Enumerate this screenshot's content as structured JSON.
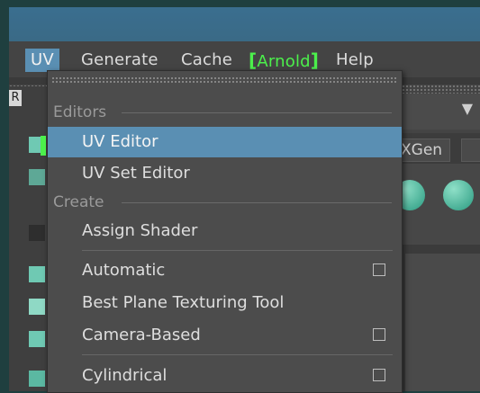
{
  "menubar": {
    "items": [
      {
        "label": "UV",
        "active": true
      },
      {
        "label": "Generate"
      },
      {
        "label": "Cache"
      },
      {
        "label": "Arnold"
      },
      {
        "label": "Help"
      }
    ]
  },
  "background": {
    "shelf_tab_label": "XGen",
    "sidebar_label": "R"
  },
  "uv_menu": {
    "sections": [
      {
        "title": "Editors"
      },
      {
        "title": "Create"
      }
    ],
    "items": [
      {
        "label": "UV Editor",
        "highlighted": true,
        "option_box": false,
        "icon": "checker-icon"
      },
      {
        "label": "UV Set Editor",
        "option_box": false,
        "icon": "uv-set-icon"
      },
      {
        "label": "Assign Shader",
        "option_box": false
      },
      {
        "label": "Automatic",
        "option_box": true,
        "icon": "cube-projection-icon"
      },
      {
        "label": "Best Plane Texturing Tool",
        "option_box": false,
        "icon": "plane-projection-icon"
      },
      {
        "label": "Camera-Based",
        "option_box": true,
        "icon": "camera-projection-icon"
      },
      {
        "label": "Cylindrical",
        "option_box": true,
        "icon": "cylinder-projection-icon"
      }
    ]
  },
  "colors": {
    "highlight": "#5a8fb3",
    "menu_bg": "#4c4c4c",
    "arnold_green": "#4cf04c",
    "desktop_bg": "#1f3f3f"
  }
}
